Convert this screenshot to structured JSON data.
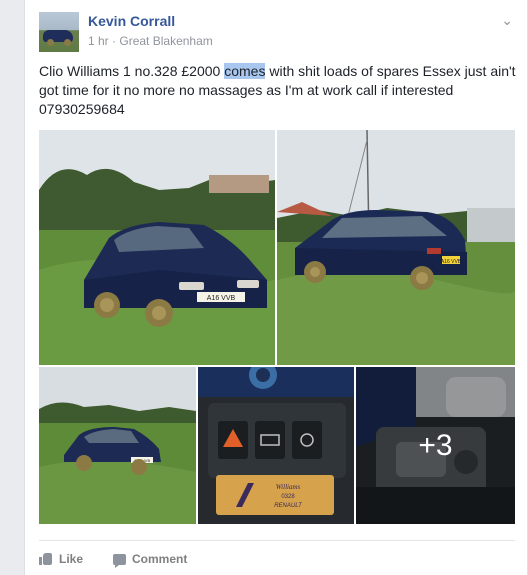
{
  "post": {
    "author": "Kevin Corrall",
    "time": "1 hr",
    "separator": "·",
    "location": "Great Blakenham",
    "text_before": "Clio Williams 1 no.328 £2000 ",
    "text_highlight": "comes",
    "text_after": " with shit loads of spares Essex just ain't got time for it no more no massages as I'm at work call if interested 07930259684",
    "more_photos": "+3"
  },
  "car_plates": {
    "front": "A16 VVB",
    "rear": "A16 VVB",
    "small": "A16 VVB"
  },
  "dashboard": {
    "badge_line1": "Williams",
    "badge_line2": "0328",
    "badge_line3": "RENAULT"
  },
  "actions": {
    "like": "Like",
    "comment": "Comment"
  }
}
